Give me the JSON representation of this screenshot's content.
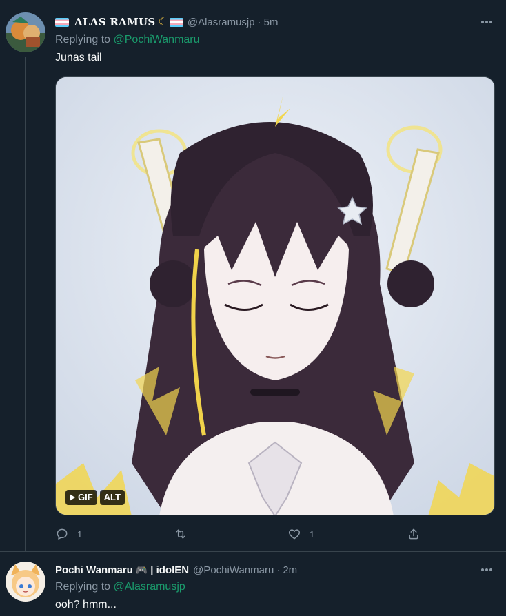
{
  "tweets": [
    {
      "display_name": "ALAS RAMUS",
      "handle": "@Alasramusjp",
      "dot": "·",
      "time": "5m",
      "replying_prefix": "Replying to",
      "replying_to": "@PochiWanmaru",
      "text": "Junas tail",
      "media": {
        "badges": [
          "GIF",
          "ALT"
        ]
      },
      "actions": {
        "reply_count": "1",
        "retweet_count": "",
        "like_count": "1"
      }
    },
    {
      "display_name": "Pochi Wanmaru",
      "name_suffix": "| idolEN",
      "name_emoji": "🎮",
      "handle": "@PochiWanmaru",
      "dot": "·",
      "time": "2m",
      "replying_prefix": "Replying to",
      "replying_to": "@Alasramusjp",
      "text": "ooh? hmm..."
    }
  ],
  "icons": {
    "more": "more-dots-icon",
    "reply": "reply-icon",
    "retweet": "retweet-icon",
    "like": "like-icon",
    "share": "share-icon",
    "play": "play-icon",
    "flag": "trans-flag-icon",
    "moon": "crescent-moon-icon"
  },
  "colors": {
    "background": "#15202b",
    "text": "#f7f9f9",
    "secondary": "#8b98a5",
    "link": "#1a9b6c",
    "divider": "#38444d"
  }
}
